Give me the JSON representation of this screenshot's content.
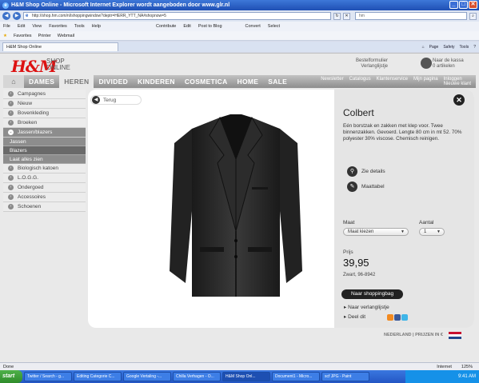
{
  "browser": {
    "title": "H&M Shop Online - Microsoft Internet Explorer wordt aangeboden door www.glr.nl",
    "url": "http://shop.hm.com/nl/shoppingwindow?deptr=HERR_YTT_NA#shopnow=5",
    "search_text": "hm",
    "menu": [
      "File",
      "Edit",
      "View",
      "Favorites",
      "Tools",
      "Help"
    ],
    "toolbar_extra": [
      "Contribute",
      "Edit",
      "Post to Blog",
      "Convert",
      "Select"
    ],
    "favorites_label": "Favorites",
    "favorites_links": [
      "Printer",
      "Webmail"
    ],
    "tab_label": "H&M Shop Online",
    "tab_tools": [
      "Page",
      "Safety",
      "Tools"
    ],
    "status_left": "Done",
    "status_zone": "Internet",
    "zoom": "125%"
  },
  "site": {
    "logo": "H&M",
    "shop_line1": "SHOP",
    "shop_line2": "ONLINE",
    "bestel_line1": "Bestelformulier",
    "bestel_line2": "Verlanglijstje",
    "cart_line1": "Naar de kassa",
    "cart_line2": "0 artikelen",
    "nav": [
      "DAMES",
      "HEREN",
      "DIVIDED",
      "KINDEREN",
      "COSMETICA",
      "HOME",
      "SALE"
    ],
    "nav_right": [
      "Newsletter",
      "Catalogus",
      "Klantenservice",
      "Mijn pagina",
      "Inloggen",
      "Nieuwe klant"
    ]
  },
  "sidebar": {
    "items_top": [
      "Campagnes",
      "Nieuw",
      "Bovenkleding",
      "Broeken"
    ],
    "open_item": "Jassen/blazers",
    "sub_items": [
      "Jassen",
      "Blazers",
      "Laat alles zien"
    ],
    "items_bottom": [
      "Biologisch katoen",
      "L.O.G.G.",
      "Ondergoed",
      "Accessoires",
      "Schoenen"
    ]
  },
  "product": {
    "back_label": "Terug",
    "name": "Colbert",
    "description": "Eén borstzak en zakken met klep voor. Twee binnenzakken. Gevoerd. Lengte 80 cm in mt 52. 70% polyester 30% viscose. Chemisch reinigen.",
    "link_details": "Zie details",
    "link_size": "Maattabel",
    "size_label": "Maat",
    "size_value": "Maat kiezen",
    "qty_label": "Aantal",
    "qty_value": "1",
    "price_label": "Prijs",
    "price": "39,95",
    "color_code": "Zwart, 96-8942",
    "buy_button": "Naar shoppingbag",
    "wishlist_link": "Naar verlanglijstje",
    "share_link": "Deel dit"
  },
  "footer": {
    "country_text": "NEDERLAND  |  PRIJZEN IN €"
  },
  "taskbar": {
    "start": "start",
    "tasks": [
      "Twitter / Search - g...",
      "Editing Categorie C...",
      "Google Vertaling -...",
      "Chilla Verhagen - O...",
      "H&M Shop Onl...",
      "Document1 - Micro...",
      "scf JPG - Paint"
    ],
    "clock": "9:41 AM"
  }
}
